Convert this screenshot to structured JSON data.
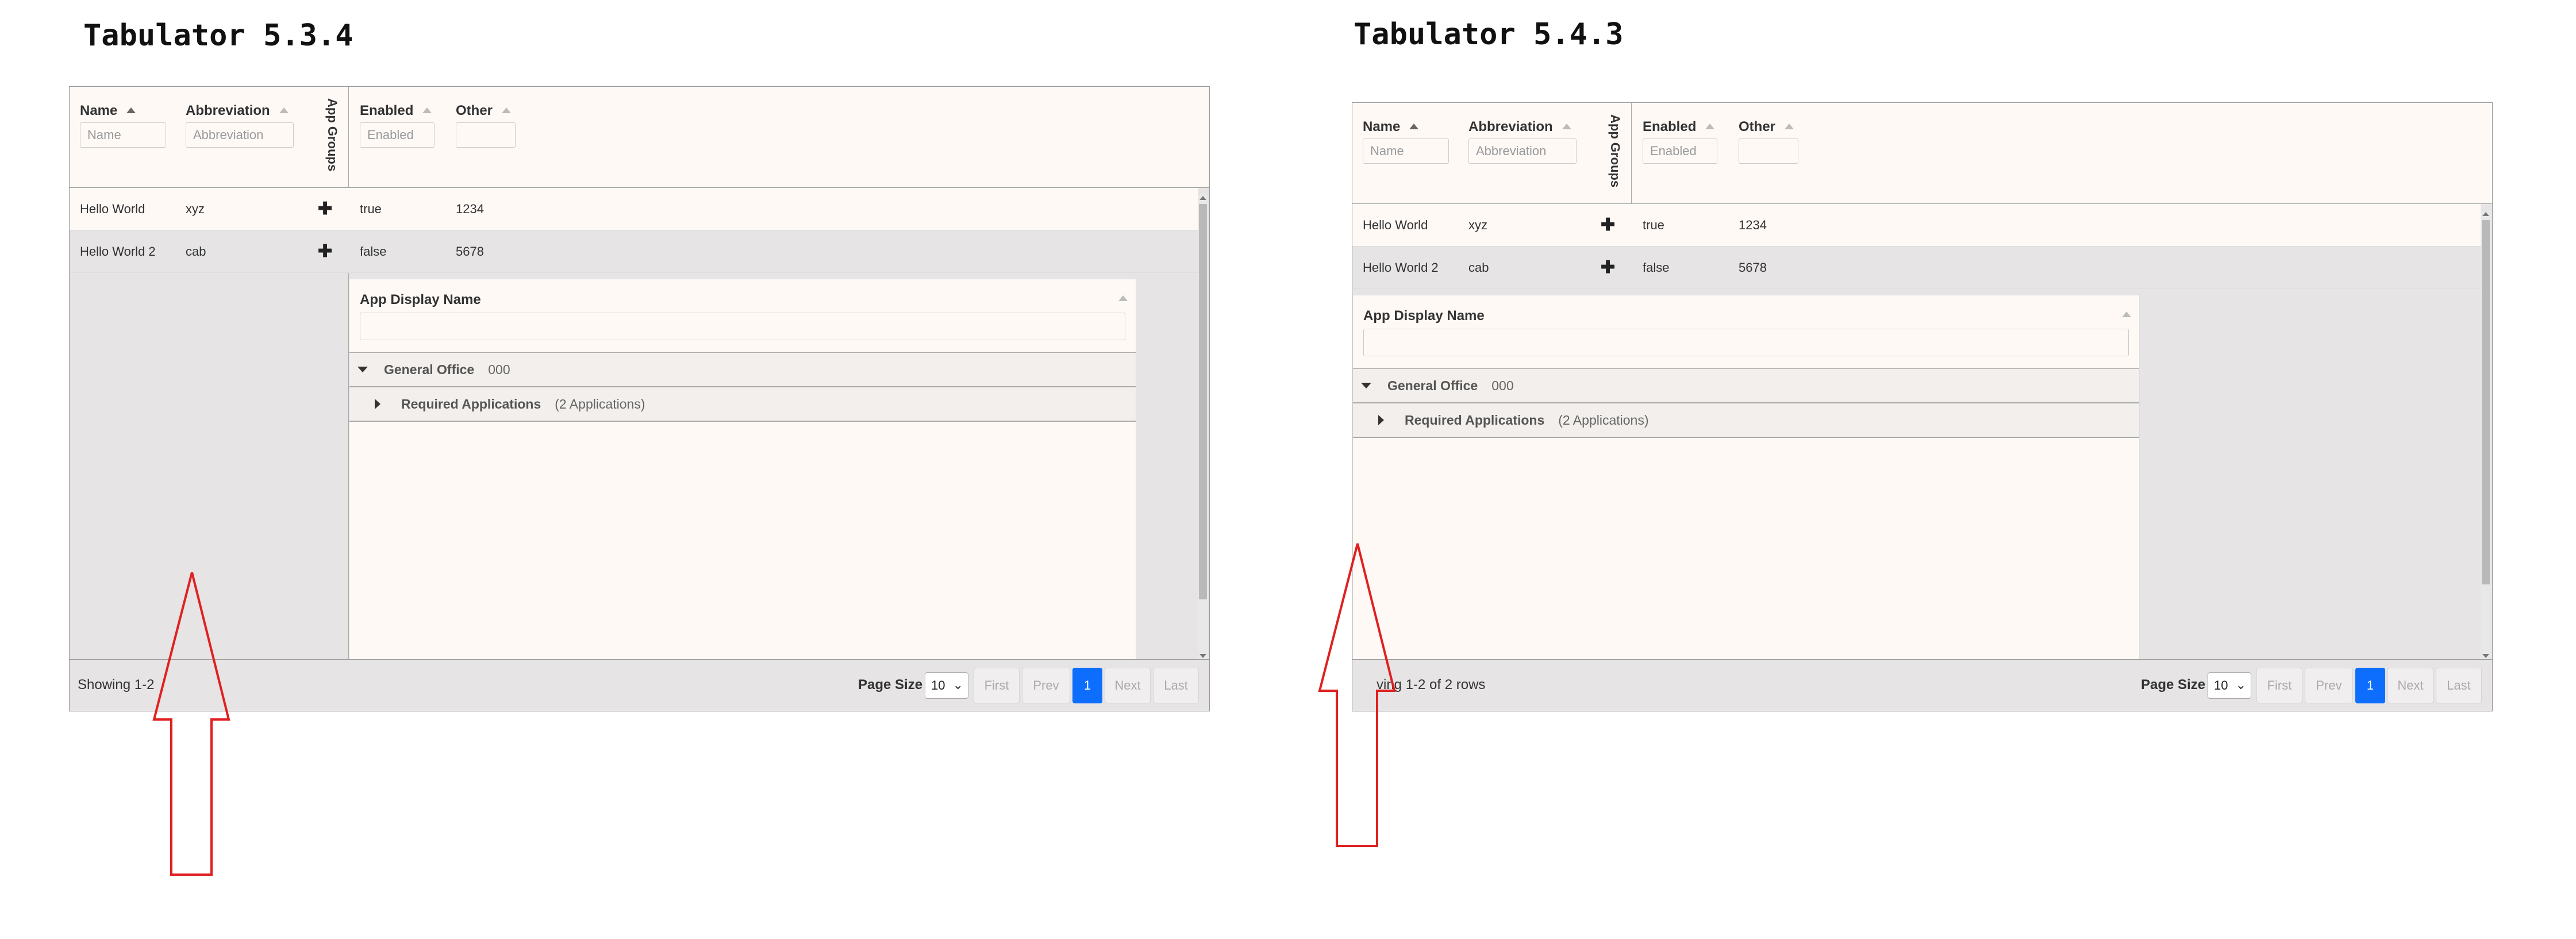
{
  "panels": [
    {
      "title": "Tabulator 5.3.4",
      "columns": {
        "name": "Name",
        "abbreviation": "Abbreviation",
        "app_groups": "App Groups",
        "enabled": "Enabled",
        "other": "Other"
      },
      "filters": {
        "name": "Name",
        "abbreviation": "Abbreviation",
        "enabled": "Enabled",
        "other": ""
      },
      "rows": [
        {
          "name": "Hello World",
          "abbreviation": "xyz",
          "toggle": "✚",
          "enabled": "true",
          "other": "1234"
        },
        {
          "name": "Hello World 2",
          "abbreviation": "cab",
          "toggle": "✚",
          "enabled": "false",
          "other": "5678"
        }
      ],
      "subtable": {
        "header": "App Display Name",
        "filter": "",
        "groups": [
          {
            "label": "General Office",
            "count": "000",
            "expanded": true
          },
          {
            "label": "Required Applications",
            "count": "(2 Applications)",
            "expanded": false
          }
        ]
      },
      "footer": {
        "status": "Showing 1-2",
        "page_size_label": "Page Size",
        "page_size_value": "10",
        "buttons": [
          "First",
          "Prev",
          "1",
          "Next",
          "Last"
        ],
        "active_page": "1"
      }
    },
    {
      "title": "Tabulator 5.4.3",
      "columns": {
        "name": "Name",
        "abbreviation": "Abbreviation",
        "app_groups": "App Groups",
        "enabled": "Enabled",
        "other": "Other"
      },
      "filters": {
        "name": "Name",
        "abbreviation": "Abbreviation",
        "enabled": "Enabled",
        "other": ""
      },
      "rows": [
        {
          "name": "Hello World",
          "abbreviation": "xyz",
          "toggle": "✚",
          "enabled": "true",
          "other": "1234"
        },
        {
          "name": "Hello World 2",
          "abbreviation": "cab",
          "toggle": "✚",
          "enabled": "false",
          "other": "5678"
        }
      ],
      "subtable": {
        "header": "App Display Name",
        "filter": "",
        "groups": [
          {
            "label": "General Office",
            "count": "000",
            "expanded": true
          },
          {
            "label": "Required Applications",
            "count": "(2 Applications)",
            "expanded": false
          }
        ]
      },
      "footer": {
        "status": "ving 1-2 of 2 rows",
        "page_size_label": "Page Size",
        "page_size_value": "10",
        "buttons": [
          "First",
          "Prev",
          "1",
          "Next",
          "Last"
        ],
        "active_page": "1"
      }
    }
  ],
  "colors": {
    "accent": "#0d6efd",
    "annotation": "#e02020",
    "header_bg": "#fff9f6",
    "frozen_bg": "#e6e4e4"
  }
}
